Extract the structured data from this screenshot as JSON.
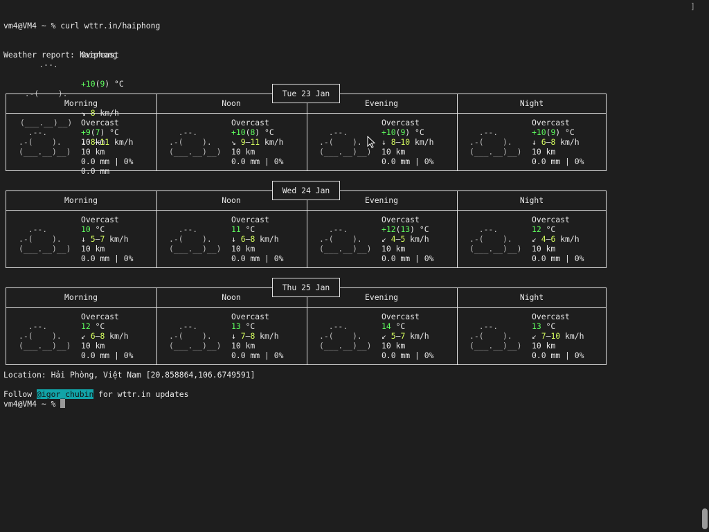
{
  "prompt_line": "vm4@VM4 ~ % curl wttr.in/haiphong",
  "report_title": "Weather report: haiphong",
  "current": {
    "art": [
      "     .--.    ",
      "  .-(    ).  ",
      " (___.__)__) "
    ],
    "condition": "Overcast",
    "temp_main": "+10",
    "temp_feels": "9",
    "temp_unit": " °C",
    "wind_dir": "↘",
    "wind_val": "8",
    "wind_unit": " km/h",
    "visibility": "10 km",
    "precip": "0.0 mm"
  },
  "periods": [
    "Morning",
    "Noon",
    "Evening",
    "Night"
  ],
  "days": [
    {
      "date": "Tue 23 Jan",
      "cells": [
        {
          "condition": "Overcast",
          "t1": "+9",
          "t2": "7",
          "dir": "↓",
          "w1": "8",
          "w2": "11",
          "vis": "10 km",
          "precip": "0.0 mm | 0%"
        },
        {
          "condition": "Overcast",
          "t1": "+10",
          "t2": "8",
          "dir": "↘",
          "w1": "9",
          "w2": "11",
          "vis": "10 km",
          "precip": "0.0 mm | 0%"
        },
        {
          "condition": "Overcast",
          "t1": "+10",
          "t2": "9",
          "dir": "↓",
          "w1": "8",
          "w2": "10",
          "vis": "10 km",
          "precip": "0.0 mm | 0%"
        },
        {
          "condition": "Overcast",
          "t1": "+10",
          "t2": "9",
          "dir": "↓",
          "w1": "6",
          "w2": "8",
          "vis": "10 km",
          "precip": "0.0 mm | 0%"
        }
      ]
    },
    {
      "date": "Wed 24 Jan",
      "cells": [
        {
          "condition": "Overcast",
          "t1": "10",
          "t2": "",
          "dir": "↓",
          "w1": "5",
          "w2": "7",
          "vis": "10 km",
          "precip": "0.0 mm | 0%"
        },
        {
          "condition": "Overcast",
          "t1": "11",
          "t2": "",
          "dir": "↓",
          "w1": "6",
          "w2": "8",
          "vis": "10 km",
          "precip": "0.0 mm | 0%"
        },
        {
          "condition": "Overcast",
          "t1": "+12",
          "t2": "13",
          "dir": "↙",
          "w1": "4",
          "w2": "5",
          "vis": "10 km",
          "precip": "0.0 mm | 0%"
        },
        {
          "condition": "Overcast",
          "t1": "12",
          "t2": "",
          "dir": "↙",
          "w1": "4",
          "w2": "6",
          "vis": "10 km",
          "precip": "0.0 mm | 0%"
        }
      ]
    },
    {
      "date": "Thu 25 Jan",
      "cells": [
        {
          "condition": "Overcast",
          "t1": "12",
          "t2": "",
          "dir": "↙",
          "w1": "6",
          "w2": "8",
          "vis": "10 km",
          "precip": "0.0 mm | 0%"
        },
        {
          "condition": "Overcast",
          "t1": "13",
          "t2": "",
          "dir": "↓",
          "w1": "7",
          "w2": "8",
          "vis": "10 km",
          "precip": "0.0 mm | 0%"
        },
        {
          "condition": "Overcast",
          "t1": "14",
          "t2": "",
          "dir": "↙",
          "w1": "5",
          "w2": "7",
          "vis": "10 km",
          "precip": "0.0 mm | 0%"
        },
        {
          "condition": "Overcast",
          "t1": "13",
          "t2": "",
          "dir": "↙",
          "w1": "7",
          "w2": "10",
          "vis": "10 km",
          "precip": "0.0 mm | 0%"
        }
      ]
    }
  ],
  "cell_art": [
    "  .--.   ",
    ".-(    ). ",
    "(___.__)__)"
  ],
  "location_line": "Location: Hải Phòng, Việt Nam [20.858864,106.6749591]",
  "follow_prefix": "Follow ",
  "follow_handle": "@igor_chubin",
  "follow_suffix": " for wttr.in updates",
  "prompt_end": "vm4@VM4 ~ % ",
  "tab_bracket": "]",
  "colors": {
    "bg": "#1e1e1e",
    "fg": "#e8e8e8",
    "green": "#5fff5f",
    "yellow": "#d7ff5f",
    "handle": "#12a4a8"
  }
}
